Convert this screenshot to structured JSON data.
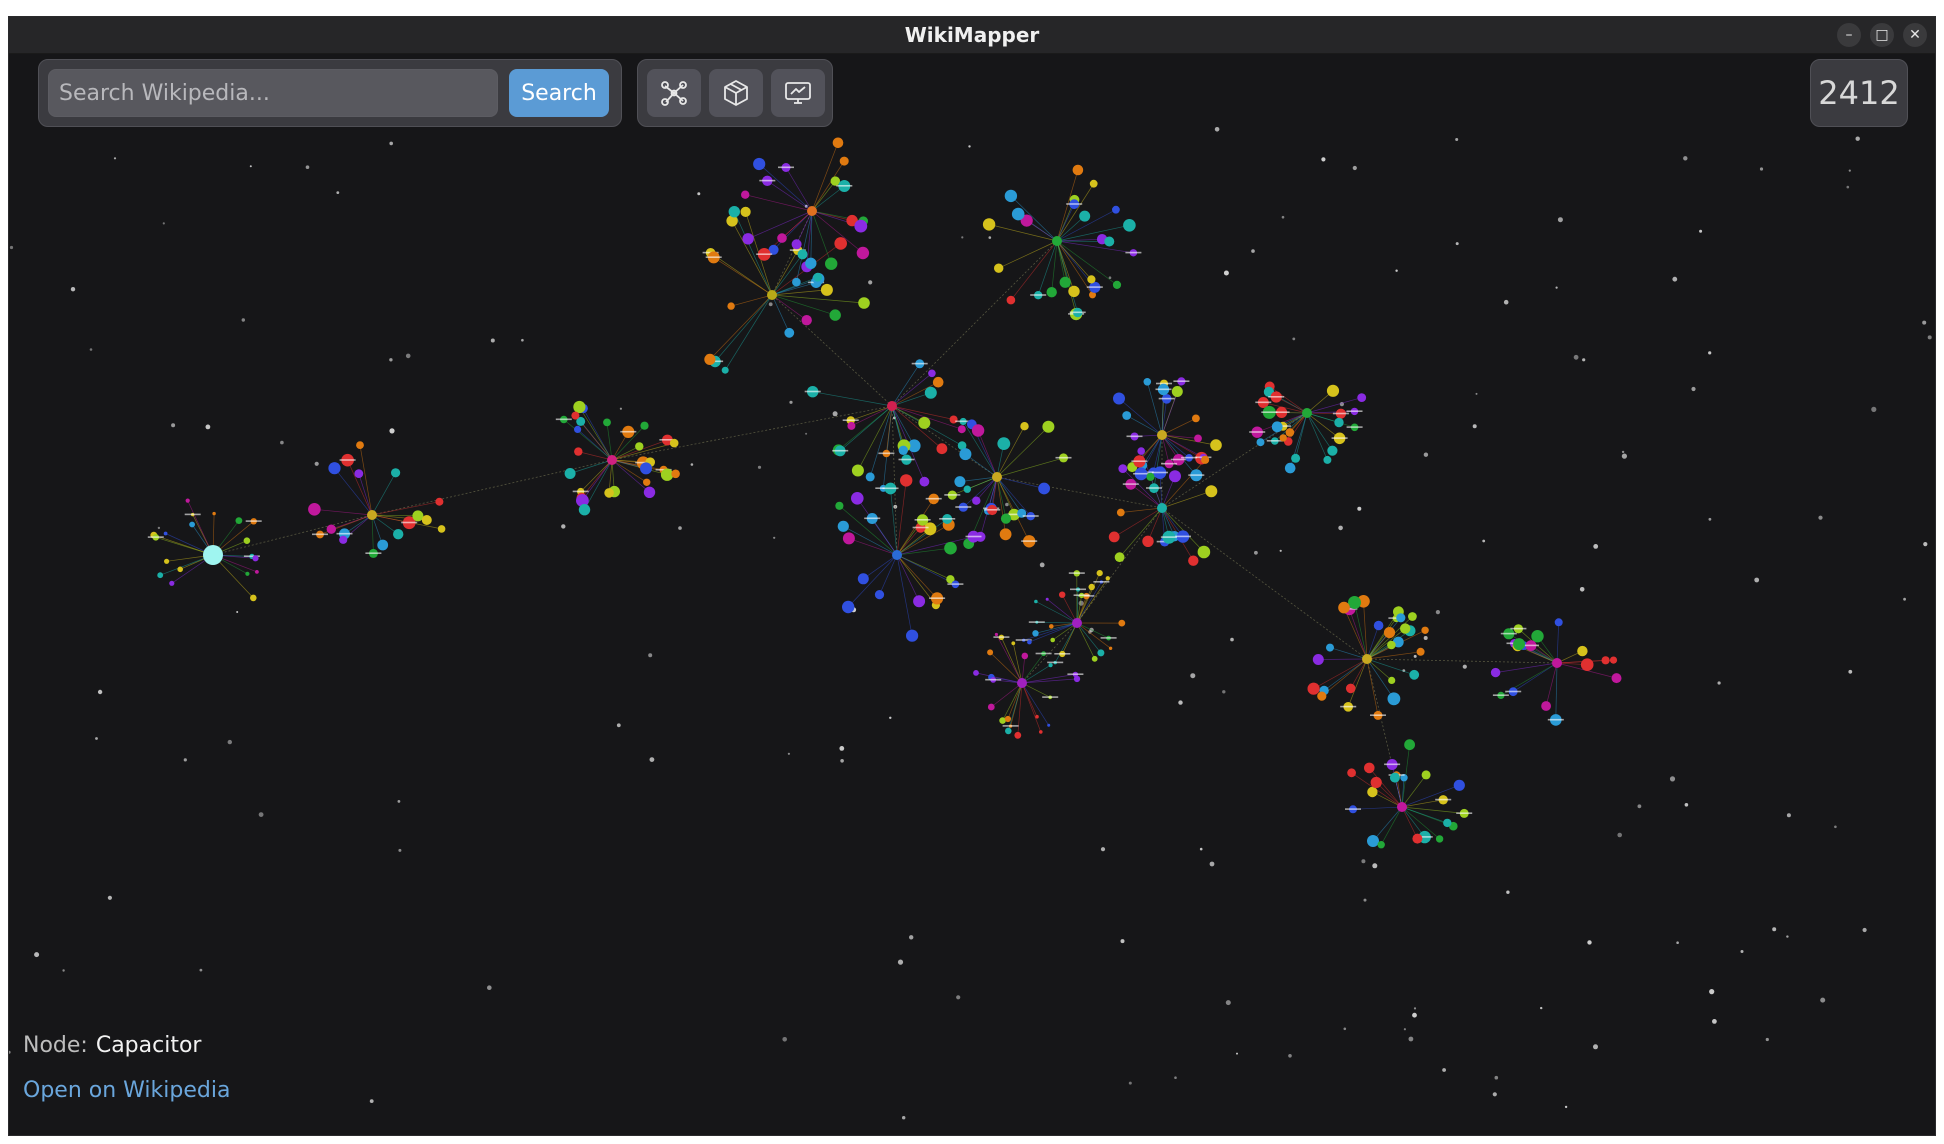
{
  "window": {
    "title": "WikiMapper",
    "controls": [
      {
        "name": "minimize-button",
        "glyph": "–"
      },
      {
        "name": "maximize-button",
        "glyph": "□"
      },
      {
        "name": "close-button",
        "glyph": "✕"
      }
    ]
  },
  "search": {
    "placeholder": "Search Wikipedia...",
    "value": "",
    "button_label": "Search"
  },
  "view_modes": [
    {
      "name": "graph-2d-icon",
      "icon": "network-graph"
    },
    {
      "name": "cube-3d-icon",
      "icon": "cube"
    },
    {
      "name": "screen-display-icon",
      "icon": "monitor"
    }
  ],
  "node_count": "2412",
  "selection": {
    "label": "Node:",
    "value": "Capacitor",
    "link_label": "Open on Wikipedia"
  },
  "colors": {
    "background": "#161618",
    "panel": "#3b3b40",
    "accent": "#5b9bd5",
    "link": "#6aa6dc",
    "selected_node": "#9ff5f0"
  }
}
